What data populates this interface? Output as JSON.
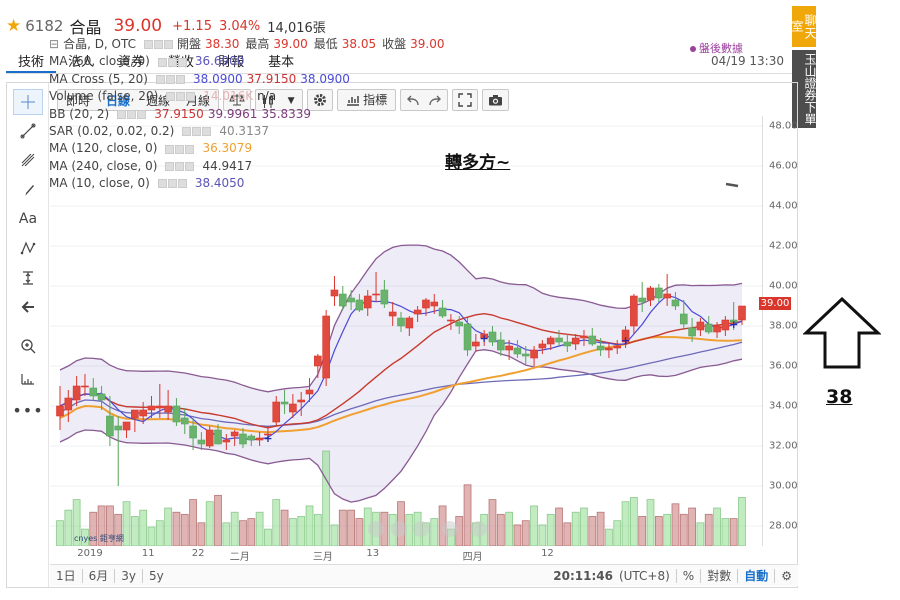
{
  "stock": {
    "code": "6182",
    "name": "合晶",
    "price": "39.00",
    "change": "+1.15",
    "change_pct": "3.04%",
    "volume": "14,016張",
    "star_icon": "star-icon"
  },
  "tabs": [
    {
      "label": "技術",
      "active": true
    },
    {
      "label": "法人"
    },
    {
      "label": "資券"
    },
    {
      "label": "營收"
    },
    {
      "label": "財報"
    },
    {
      "label": "基本"
    }
  ],
  "datetime": "04/19 13:30",
  "side": {
    "chat": "聊天室",
    "trade": "玉山證券下單"
  },
  "toolbar": {
    "periods": [
      "即時",
      "日線",
      "週線",
      "月線"
    ],
    "active_period": "日線",
    "indicators_label": "指標"
  },
  "legend": {
    "main_title": "合晶, D, OTC",
    "ohlc": {
      "open_label": "開盤",
      "open": "38.30",
      "high_label": "最高",
      "high": "39.00",
      "low_label": "最低",
      "low": "38.05",
      "close_label": "收盤",
      "close": "39.00"
    },
    "rows": [
      {
        "name": "MA (60, close, 0)",
        "values": [
          "36.6900"
        ],
        "colors": [
          "#5a54b8"
        ]
      },
      {
        "name": "MA Cross (5, 20)",
        "values": [
          "38.0900",
          "37.9150",
          "38.0900"
        ],
        "colors": [
          "#4a4ad6",
          "#c33",
          "#4a4ad6"
        ]
      },
      {
        "name": "Volume (false, 20)",
        "values": [
          "14.016K",
          "n/a"
        ],
        "colors": [
          "#e6b3b3",
          "#333"
        ]
      },
      {
        "name": "BB (20, 2)",
        "values": [
          "37.9150",
          "39.9961",
          "35.8339"
        ],
        "colors": [
          "#c33",
          "#7b3b7b",
          "#7b3b7b"
        ]
      },
      {
        "name": "SAR (0.02, 0.02, 0.2)",
        "values": [
          "40.3137"
        ],
        "colors": [
          "#888"
        ]
      },
      {
        "name": "MA (120, close, 0)",
        "values": [
          "36.3079"
        ],
        "colors": [
          "#f0a030"
        ]
      },
      {
        "name": "MA (240, close, 0)",
        "values": [
          "44.9417"
        ],
        "colors": [
          "#444"
        ]
      },
      {
        "name": "MA (10, close, 0)",
        "values": [
          "38.4050"
        ],
        "colors": [
          "#5a54b8"
        ]
      }
    ],
    "after_hours": "盤後數據"
  },
  "annotation": {
    "text": "轉多方~",
    "number": "38"
  },
  "price_tag": "39.00",
  "yaxis_ticks": [
    "48.00",
    "46.00",
    "44.00",
    "42.00",
    "40.00",
    "38.00",
    "36.00",
    "34.00",
    "32.00",
    "30.00",
    "28.00"
  ],
  "xaxis_ticks": [
    "2019",
    "11",
    "22",
    "二月",
    "三月",
    "13",
    "四月",
    "12"
  ],
  "bottom": {
    "ranges": [
      "1日",
      "6月",
      "3y",
      "5y"
    ],
    "time": "20:11:46",
    "tz": "(UTC+8)",
    "pct": "%",
    "log": "對數",
    "auto": "自動"
  },
  "watermark": "cnyes 鉅亨網",
  "chart_data": {
    "type": "candlestick",
    "ylim": [
      27,
      48.5
    ],
    "candles": [
      [
        33.5,
        35.0,
        32.8,
        34.0
      ],
      [
        33.8,
        34.8,
        33.2,
        34.4
      ],
      [
        34.3,
        35.5,
        34.0,
        35.0
      ],
      [
        35.0,
        35.6,
        34.5,
        35.0
      ],
      [
        34.9,
        35.4,
        34.3,
        34.5
      ],
      [
        34.6,
        35.0,
        33.8,
        34.3
      ],
      [
        33.5,
        34.5,
        32.0,
        32.5
      ],
      [
        33.0,
        33.5,
        30.0,
        32.8
      ],
      [
        32.8,
        33.2,
        32.4,
        33.2
      ],
      [
        33.4,
        33.8,
        32.7,
        33.8
      ],
      [
        33.5,
        34.2,
        33.1,
        33.8
      ],
      [
        33.8,
        34.5,
        33.4,
        34.0
      ],
      [
        33.9,
        35.1,
        33.4,
        34.0
      ],
      [
        33.7,
        34.8,
        33.3,
        34.0
      ],
      [
        34.0,
        34.4,
        33.0,
        33.2
      ],
      [
        33.4,
        33.9,
        32.6,
        33.1
      ],
      [
        33.0,
        33.4,
        31.8,
        32.4
      ],
      [
        32.3,
        32.7,
        31.8,
        32.1
      ],
      [
        32.0,
        33.0,
        31.9,
        32.8
      ],
      [
        32.8,
        33.1,
        32.1,
        32.1
      ],
      [
        32.2,
        32.6,
        31.8,
        32.3
      ],
      [
        32.5,
        32.8,
        32.0,
        32.7
      ],
      [
        32.6,
        32.9,
        31.9,
        32.1
      ],
      [
        32.5,
        32.6,
        32.0,
        32.3
      ],
      [
        32.3,
        32.7,
        32.0,
        32.4
      ],
      [
        32.6,
        33.0,
        32.2,
        32.6
      ],
      [
        33.2,
        34.5,
        33.0,
        34.2
      ],
      [
        34.2,
        34.8,
        33.6,
        34.1
      ],
      [
        33.7,
        34.6,
        33.4,
        34.1
      ],
      [
        34.2,
        34.7,
        33.5,
        34.3
      ],
      [
        34.6,
        35.4,
        34.2,
        34.8
      ],
      [
        36.0,
        36.6,
        35.4,
        36.5
      ],
      [
        35.4,
        38.8,
        35.0,
        38.5
      ],
      [
        39.5,
        40.5,
        39.0,
        39.8
      ],
      [
        39.6,
        40.0,
        38.8,
        39.0
      ],
      [
        39.4,
        39.8,
        38.8,
        39.2
      ],
      [
        39.3,
        39.6,
        38.7,
        38.8
      ],
      [
        38.9,
        39.8,
        38.5,
        39.5
      ],
      [
        39.6,
        40.7,
        39.2,
        39.6
      ],
      [
        39.8,
        40.3,
        38.9,
        39.1
      ],
      [
        38.5,
        39.2,
        38.0,
        38.7
      ],
      [
        38.4,
        38.7,
        37.7,
        38.0
      ],
      [
        37.9,
        38.5,
        37.5,
        38.4
      ],
      [
        38.6,
        39.0,
        38.2,
        38.8
      ],
      [
        38.9,
        39.4,
        38.5,
        39.3
      ],
      [
        39.0,
        39.6,
        38.6,
        39.2
      ],
      [
        38.9,
        39.3,
        38.4,
        38.5
      ],
      [
        38.3,
        38.6,
        37.8,
        38.3
      ],
      [
        38.2,
        38.5,
        37.6,
        38.0
      ],
      [
        38.1,
        38.4,
        36.5,
        36.8
      ],
      [
        37.0,
        37.6,
        36.7,
        37.2
      ],
      [
        37.4,
        37.8,
        37.0,
        37.6
      ],
      [
        37.7,
        38.0,
        37.0,
        37.2
      ],
      [
        37.3,
        37.7,
        36.5,
        36.8
      ],
      [
        36.8,
        37.3,
        36.3,
        37.0
      ],
      [
        36.9,
        37.3,
        36.4,
        36.6
      ],
      [
        36.6,
        37.0,
        36.1,
        36.5
      ],
      [
        36.4,
        37.0,
        36.0,
        36.8
      ],
      [
        36.9,
        37.3,
        36.6,
        37.1
      ],
      [
        37.1,
        37.5,
        36.8,
        37.4
      ],
      [
        37.4,
        37.8,
        37.0,
        37.2
      ],
      [
        37.2,
        37.6,
        36.7,
        37.0
      ],
      [
        37.1,
        37.6,
        36.8,
        37.4
      ],
      [
        37.4,
        37.8,
        37.0,
        37.5
      ],
      [
        37.5,
        37.9,
        37.0,
        37.1
      ],
      [
        37.0,
        37.4,
        36.5,
        36.8
      ],
      [
        36.8,
        37.2,
        36.4,
        36.9
      ],
      [
        36.9,
        37.3,
        36.6,
        37.0
      ],
      [
        37.2,
        38.0,
        36.9,
        37.8
      ],
      [
        38.0,
        39.6,
        37.6,
        39.5
      ],
      [
        39.4,
        40.2,
        38.7,
        39.2
      ],
      [
        39.3,
        40.0,
        39.0,
        39.9
      ],
      [
        39.9,
        40.1,
        39.2,
        39.4
      ],
      [
        39.4,
        40.6,
        39.0,
        39.6
      ],
      [
        39.3,
        39.7,
        38.8,
        39.0
      ],
      [
        38.6,
        39.3,
        37.8,
        38.1
      ],
      [
        37.9,
        38.4,
        37.2,
        37.5
      ],
      [
        37.8,
        38.4,
        37.5,
        38.2
      ],
      [
        38.1,
        38.5,
        37.6,
        37.7
      ],
      [
        37.7,
        38.2,
        37.4,
        38.0
      ],
      [
        37.8,
        38.5,
        37.5,
        38.3
      ],
      [
        38.3,
        39.2,
        37.8,
        38.2
      ],
      [
        38.3,
        39.0,
        38.05,
        39.0
      ]
    ]
  }
}
